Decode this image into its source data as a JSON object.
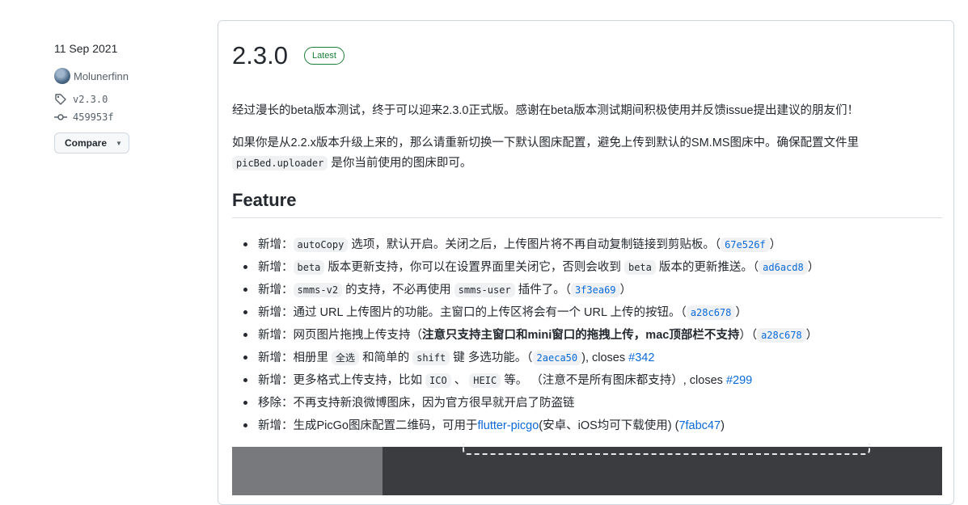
{
  "sidebar": {
    "date": "11 Sep 2021",
    "author": "Molunerfinn",
    "tag": "v2.3.0",
    "commit": "459953f",
    "compare_label": "Compare"
  },
  "release": {
    "version": "2.3.0",
    "badge": "Latest",
    "intro": "经过漫长的beta版本测试，终于可以迎来2.3.0正式版。感谢在beta版本测试期间积极使用并反馈issue提出建议的朋友们！",
    "upgrade_line1": "如果你是从2.2.x版本升级上来的，那么请重新切换一下默认图床配置，避免上传到默认的SM.MS图床中。确保配置文件里",
    "upgrade_code": "picBed.uploader",
    "upgrade_line2": " 是你当前使用的图床即可。",
    "feature_heading": "Feature",
    "items": [
      {
        "prefix": "新增：",
        "code1": "autoCopy",
        "text1": " 选项，默认开启。关闭之后，上传图片将不再自动复制链接到剪贴板。（",
        "sha": "67e526f",
        "end": "）"
      },
      {
        "prefix": "新增：",
        "code1": "beta",
        "text1": " 版本更新支持，你可以在设置界面里关闭它，否则会收到 ",
        "code2": "beta",
        "text2": " 版本的更新推送。（",
        "sha": "ad6acd8",
        "end": "）"
      },
      {
        "prefix": "新增：",
        "code1": "smms-v2",
        "text1": " 的支持，不必再使用 ",
        "code2": "smms-user",
        "text2": " 插件了。（",
        "sha": "3f3ea69",
        "end": "）"
      },
      {
        "prefix": "新增：",
        "text1": "通过 URL 上传图片的功能。主窗口的上传区将会有一个 URL 上传的按钮。（",
        "sha": "a28c678",
        "end": "）"
      },
      {
        "prefix": "新增：",
        "text1": "网页图片拖拽上传支持（",
        "bold": "注意只支持主窗口和mini窗口的拖拽上传，mac顶部栏不支持",
        "text2": "）（",
        "sha": "a28c678",
        "end": "）"
      },
      {
        "prefix": "新增：",
        "text1": "相册里 ",
        "code1": "全选",
        "text2": " 和简单的 ",
        "code2": "shift",
        "text3": " 键 多选功能。（",
        "sha": "2aeca50",
        "end": "), closes ",
        "link": "#342"
      },
      {
        "prefix": "新增：",
        "text1": "更多格式上传支持，比如 ",
        "code1": "ICO",
        "text2": " 、 ",
        "code2": "HEIC",
        "text3": " 等。 （注意不是所有图床都支持）, closes ",
        "link": "#299"
      },
      {
        "prefix": "移除：",
        "text1": "不再支持新浪微博图床，因为官方很早就开启了防盗链"
      },
      {
        "prefix": "新增：",
        "text1": "生成PicGo图床配置二维码，可用于",
        "link": "flutter-picgo",
        "text2": "(安卓、iOS均可下载使用) (",
        "link2": "7fabc47",
        "end": ")"
      }
    ]
  },
  "colors": {
    "accent": "#0969da",
    "latest_badge": "#1a7f37"
  }
}
